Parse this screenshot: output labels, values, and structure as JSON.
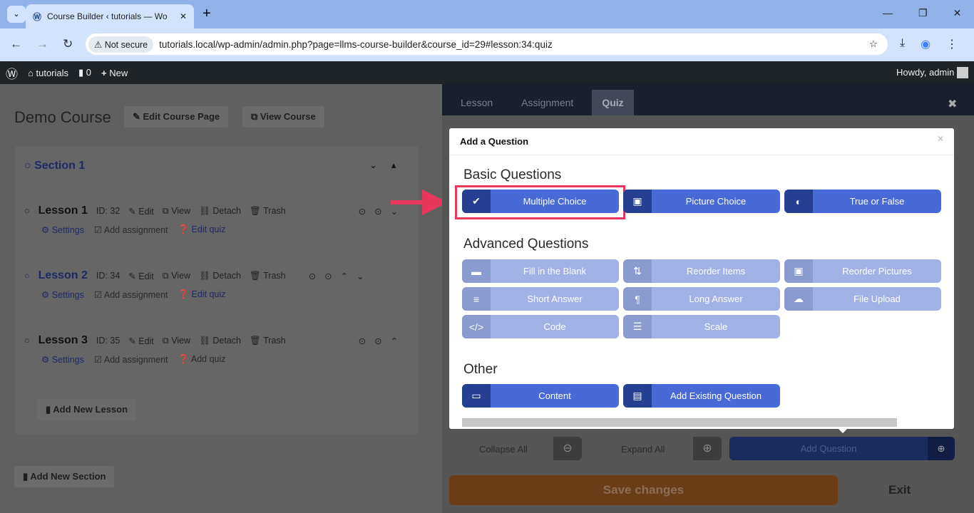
{
  "browser": {
    "tab_title": "Course Builder ‹ tutorials — Wo",
    "not_secure": "Not secure",
    "url": "tutorials.local/wp-admin/admin.php?page=llms-course-builder&course_id=29#lesson:34:quiz"
  },
  "wpbar": {
    "site": "tutorials",
    "comments": "0",
    "new": "New",
    "howdy": "Howdy, admin"
  },
  "course": {
    "title": "Demo Course",
    "edit_page": "Edit Course Page",
    "view_course": "View Course",
    "section": "Section 1",
    "add_lesson": "Add New Lesson",
    "add_section": "Add New Section",
    "lessons": [
      {
        "title": "Lesson 1",
        "id": "ID: 32",
        "edit": "Edit",
        "view": "View",
        "detach": "Detach",
        "trash": "Trash",
        "settings": "Settings",
        "assignment": "Add assignment",
        "quiz": "Edit quiz"
      },
      {
        "title": "Lesson 2",
        "id": "ID: 34",
        "edit": "Edit",
        "view": "View",
        "detach": "Detach",
        "trash": "Trash",
        "settings": "Settings",
        "assignment": "Add assignment",
        "quiz": "Edit quiz"
      },
      {
        "title": "Lesson 3",
        "id": "ID: 35",
        "edit": "Edit",
        "view": "View",
        "detach": "Detach",
        "trash": "Trash",
        "settings": "Settings",
        "assignment": "Add assignment",
        "quiz": "Add quiz"
      }
    ]
  },
  "panel": {
    "tabs": [
      "Lesson",
      "Assignment",
      "Quiz"
    ],
    "active_tab": "Quiz",
    "collapse": "Collapse All",
    "expand": "Expand All",
    "add_question": "Add Question",
    "save": "Save changes",
    "exit": "Exit"
  },
  "modal": {
    "title": "Add a Question",
    "basic": "Basic Questions",
    "advanced": "Advanced Questions",
    "other": "Other",
    "basic_items": [
      "Multiple Choice",
      "Picture Choice",
      "True or False"
    ],
    "advanced_items": [
      "Fill in the Blank",
      "Reorder Items",
      "Reorder Pictures",
      "Short Answer",
      "Long Answer",
      "File Upload",
      "Code",
      "Scale"
    ],
    "other_items": [
      "Content",
      "Add Existing Question"
    ]
  },
  "colors": {
    "primary": "#476ad7",
    "disabled": "#a2b1e6",
    "highlight": "#e8365d"
  }
}
